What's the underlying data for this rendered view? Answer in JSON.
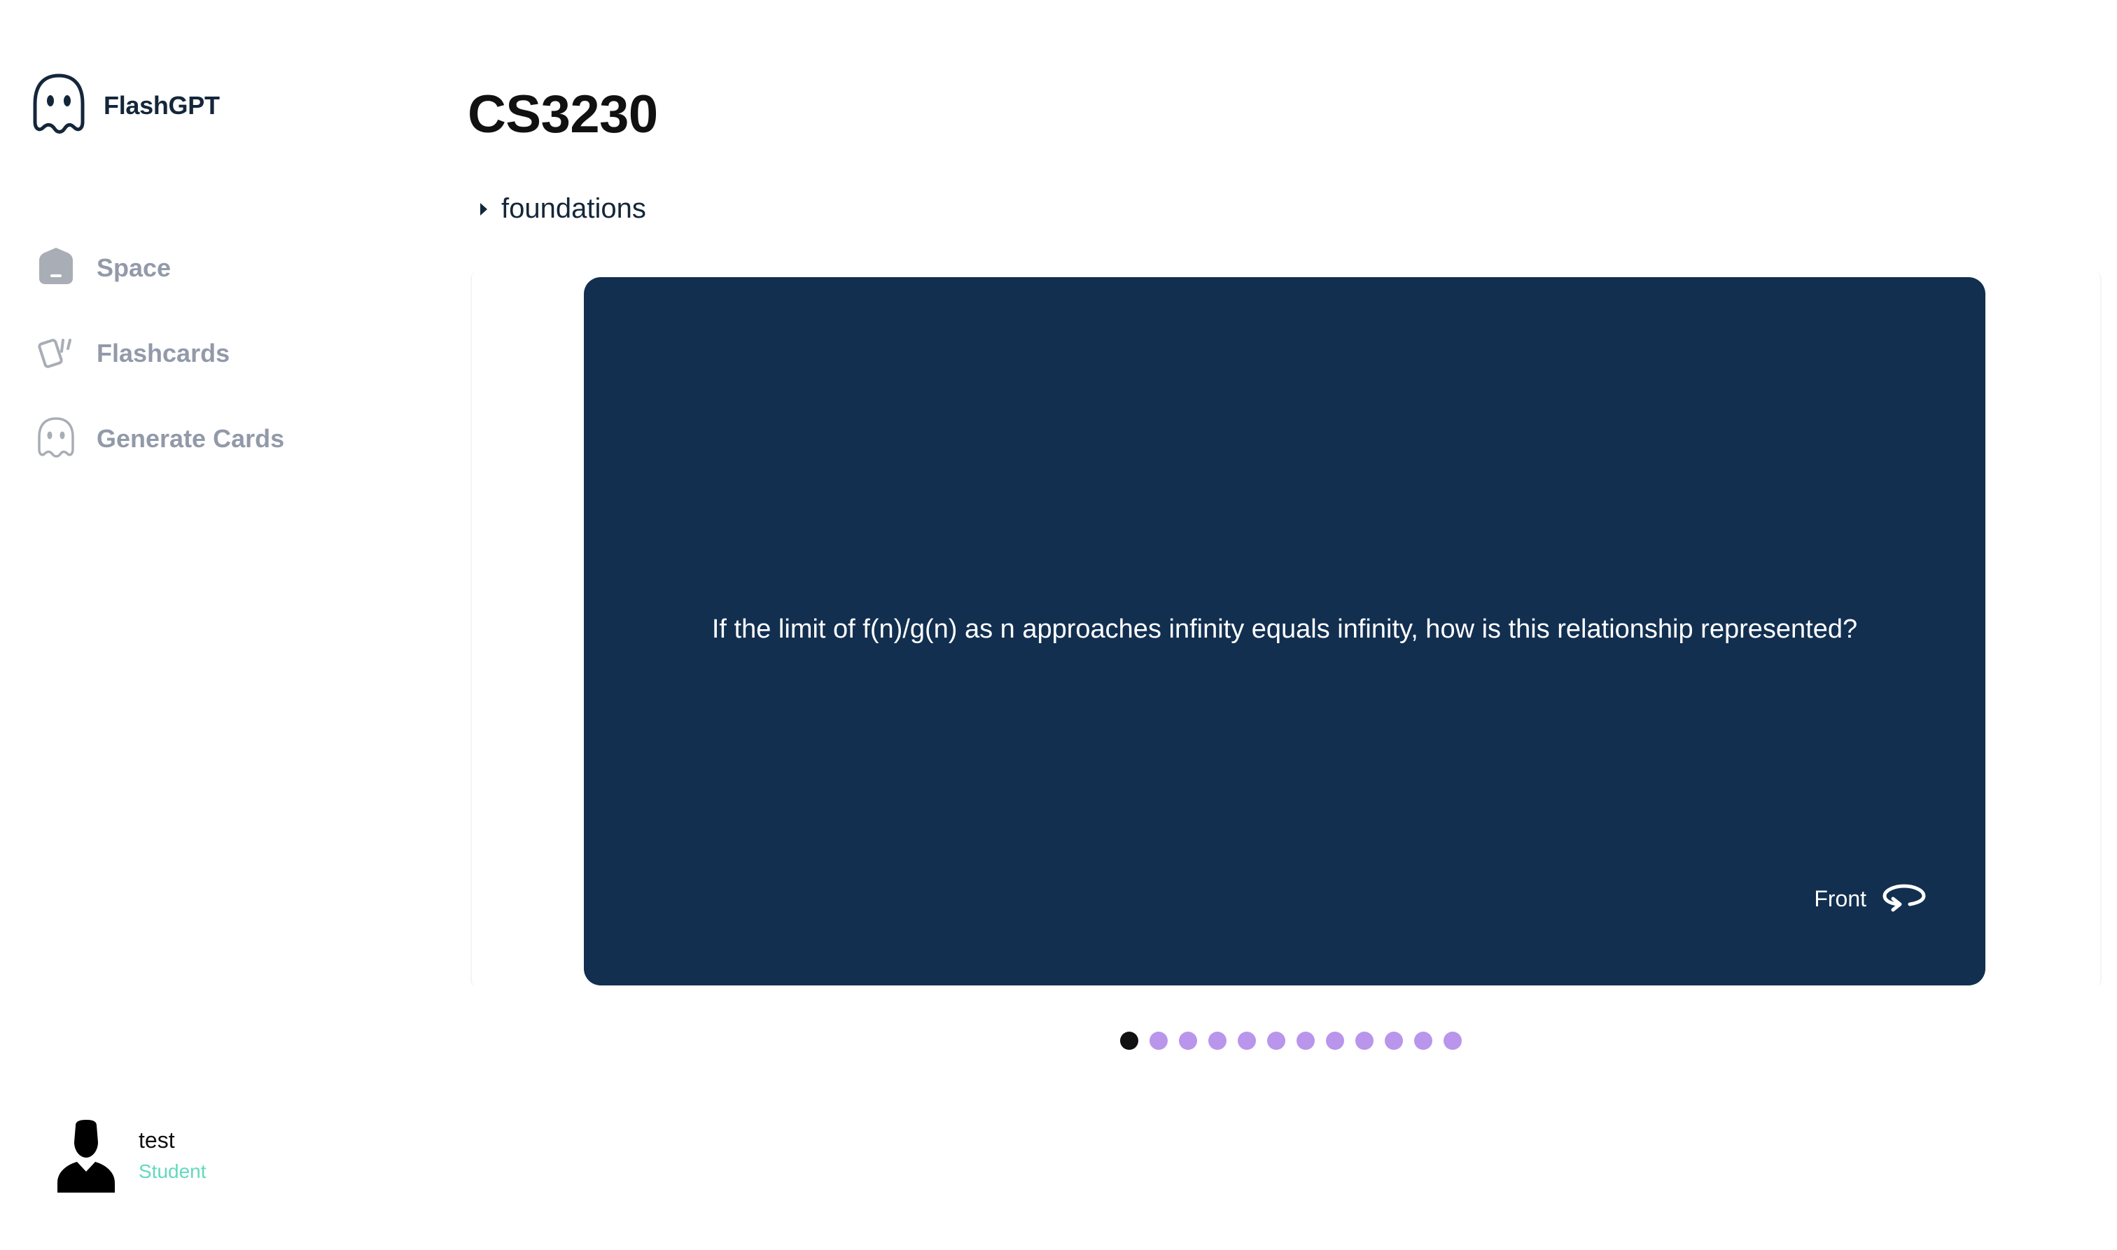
{
  "app": {
    "name": "FlashGPT"
  },
  "sidebar": {
    "items": [
      {
        "label": "Space",
        "icon": "home-icon"
      },
      {
        "label": "Flashcards",
        "icon": "cards-icon"
      },
      {
        "label": "Generate Cards",
        "icon": "ghost-icon"
      }
    ]
  },
  "user": {
    "name": "test",
    "role": "Student"
  },
  "main": {
    "title": "CS3230",
    "topic": "foundations",
    "card": {
      "text": "If the limit of f(n)/g(n) as n approaches infinity equals infinity, how is this relationship represented?",
      "side": "Front"
    },
    "carousel": {
      "total_cards": 12,
      "active_index": 0
    }
  },
  "colors": {
    "card_background": "#122f50",
    "dot_inactive": "#b995ec",
    "dot_active": "#111111",
    "role_accent": "#64d8bf",
    "nav_text": "#929aa9"
  }
}
